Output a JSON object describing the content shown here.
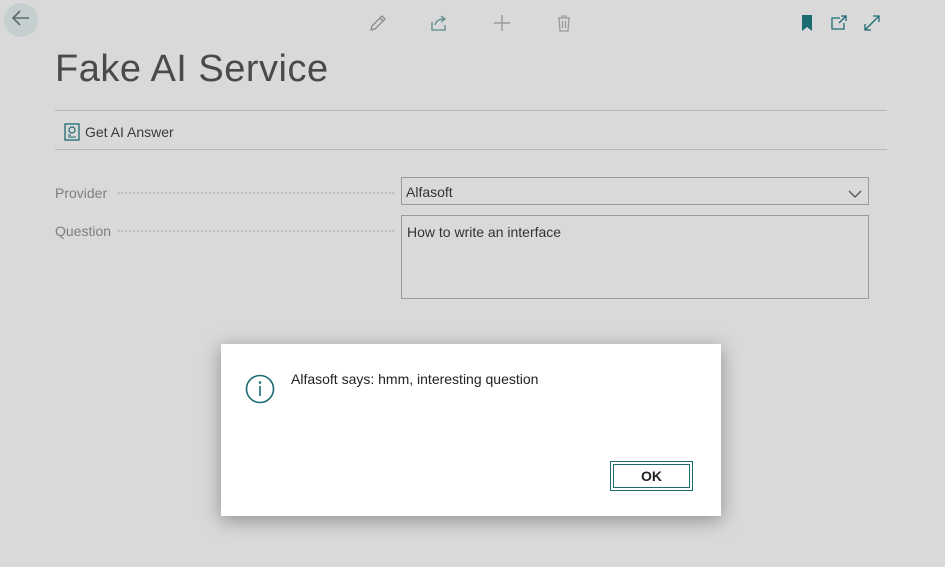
{
  "page": {
    "title": "Fake AI Service",
    "background": "#d9d9d9",
    "accent": "#1b6b72"
  },
  "toolbar": {
    "icons": [
      "back-arrow-icon",
      "edit-pencil-icon",
      "share-icon",
      "add-plus-icon",
      "delete-trash-icon",
      "bookmark-icon",
      "open-in-new-window-icon",
      "expand-icon"
    ]
  },
  "actions": {
    "get_ai_answer_label": "Get AI Answer"
  },
  "form": {
    "provider_label": "Provider",
    "provider_value": "Alfasoft",
    "question_label": "Question",
    "question_value": "How to write an interface"
  },
  "dialog": {
    "message": "Alfasoft says: hmm, interesting question",
    "ok_label": "OK"
  }
}
